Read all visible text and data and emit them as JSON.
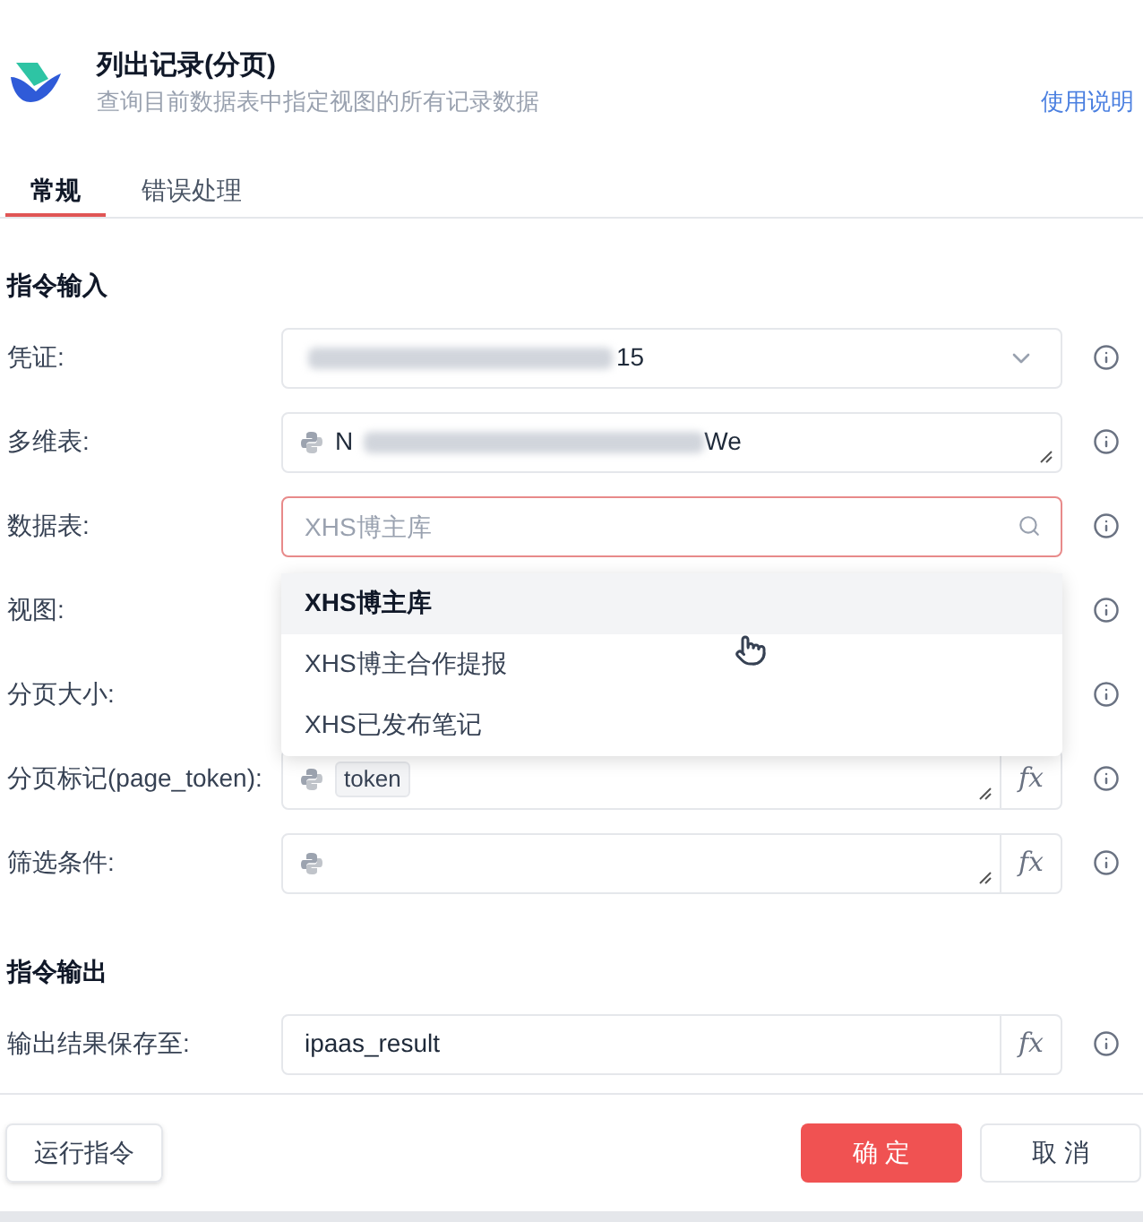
{
  "header": {
    "title": "列出记录(分页)",
    "subtitle": "查询目前数据表中指定视图的所有记录数据",
    "help_link": "使用说明"
  },
  "tabs": [
    {
      "label": "常规",
      "selected": true
    },
    {
      "label": "错误处理",
      "selected": false
    }
  ],
  "sections": [
    {
      "title": "指令输入",
      "fields": [
        {
          "label": "凭证:",
          "kind": "select",
          "visible_end": "15"
        },
        {
          "label": "多维表:",
          "kind": "code",
          "visible_start": "N",
          "visible_end": "We"
        },
        {
          "label": "数据表:",
          "kind": "search",
          "placeholder": "XHS博主库",
          "focused": true,
          "dropdown": [
            {
              "label": "XHS博主库",
              "selected": true
            },
            {
              "label": "XHS博主合作提报",
              "selected": false
            },
            {
              "label": "XHS已发布笔记",
              "selected": false
            }
          ]
        },
        {
          "label": "视图:",
          "kind": "covered"
        },
        {
          "label": "分页大小:",
          "kind": "covered"
        },
        {
          "label": "分页标记(page_token):",
          "kind": "code",
          "tag": "token",
          "fx": "fx"
        },
        {
          "label": "筛选条件:",
          "kind": "code",
          "fx": "fx"
        }
      ]
    },
    {
      "title": "指令输出",
      "fields": [
        {
          "label": "输出结果保存至:",
          "kind": "text",
          "value": "ipaas_result",
          "fx": "fx"
        }
      ]
    }
  ],
  "footer": {
    "run_button": "运行指令",
    "confirm_button": "确 定",
    "cancel_button": "取 消"
  }
}
